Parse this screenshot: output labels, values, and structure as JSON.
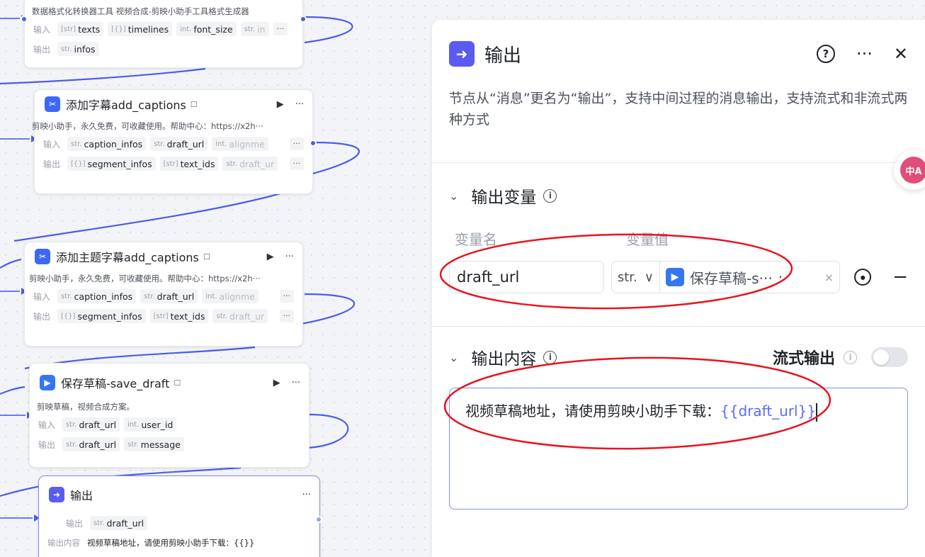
{
  "colors": {
    "accent": "#5a5bf0",
    "edge": "#4d5bf0",
    "annotation": "#e8141e"
  },
  "nodes": {
    "format": {
      "desc": "数据格式化转换器工具 视频合成-剪映小助手工具格式生成器",
      "input_label": "输入",
      "output_label": "输出",
      "inputs": [
        {
          "type": "[str]",
          "name": "texts"
        },
        {
          "type": "[{}]",
          "name": "timelines"
        },
        {
          "type": "int.",
          "name": "font_size"
        },
        {
          "type": "str.",
          "name": "in"
        }
      ],
      "outputs": [
        {
          "type": "str.",
          "name": "infos"
        }
      ],
      "more": "···"
    },
    "captions": {
      "title": "添加字幕add_captions",
      "desc": "剪映小助手，永久免费，可收藏使用。帮助中心：https://x2h···",
      "input_label": "输入",
      "output_label": "输出",
      "inputs": [
        {
          "type": "str.",
          "name": "caption_infos"
        },
        {
          "type": "str.",
          "name": "draft_url"
        },
        {
          "type": "int.",
          "name": "alignme"
        }
      ],
      "outputs": [
        {
          "type": "[{}]",
          "name": "segment_infos"
        },
        {
          "type": "[str]",
          "name": "text_ids"
        },
        {
          "type": "str.",
          "name": "draft_ur"
        }
      ],
      "more": "···"
    },
    "theme_captions": {
      "title": "添加主题字幕add_captions",
      "desc": "剪映小助手，永久免费，可收藏使用。帮助中心：https://x2h···",
      "input_label": "输入",
      "output_label": "输出",
      "inputs": [
        {
          "type": "str.",
          "name": "caption_infos"
        },
        {
          "type": "str.",
          "name": "draft_url"
        },
        {
          "type": "int.",
          "name": "alignme"
        }
      ],
      "outputs": [
        {
          "type": "[{}]",
          "name": "segment_infos"
        },
        {
          "type": "[str]",
          "name": "text_ids"
        },
        {
          "type": "str.",
          "name": "draft_ur"
        }
      ],
      "more": "···"
    },
    "save_draft": {
      "title": "保存草稿-save_draft",
      "desc": "剪映草稿，视频合成方案。",
      "input_label": "输入",
      "output_label": "输出",
      "inputs": [
        {
          "type": "str.",
          "name": "draft_url"
        },
        {
          "type": "int.",
          "name": "user_id"
        }
      ],
      "outputs": [
        {
          "type": "str.",
          "name": "draft_url"
        },
        {
          "type": "str.",
          "name": "message"
        }
      ]
    },
    "output": {
      "title": "输出",
      "output_label": "输出",
      "output_var": {
        "type": "str.",
        "name": "draft_url"
      },
      "content_label": "输出内容",
      "content_value": "视频草稿地址，请使用剪映小助手下载：{{}}"
    }
  },
  "panel": {
    "title": "输出",
    "description": "节点从“消息”更名为“输出”，支持中间过程的消息输出，支持流式和非流式两种方式",
    "vars_section": {
      "title": "输出变量",
      "col_name": "变量名",
      "col_value": "变量值",
      "var_name": "draft_url",
      "type": "str.",
      "ref_label": "保存草稿-s···",
      "ref_tail": "·"
    },
    "content_section": {
      "title": "输出内容",
      "stream_label": "流式输出",
      "text": "视频草稿地址，请使用剪映小助手下载：",
      "var_token": "{{draft_url}}"
    },
    "translate_badge": "中A"
  }
}
